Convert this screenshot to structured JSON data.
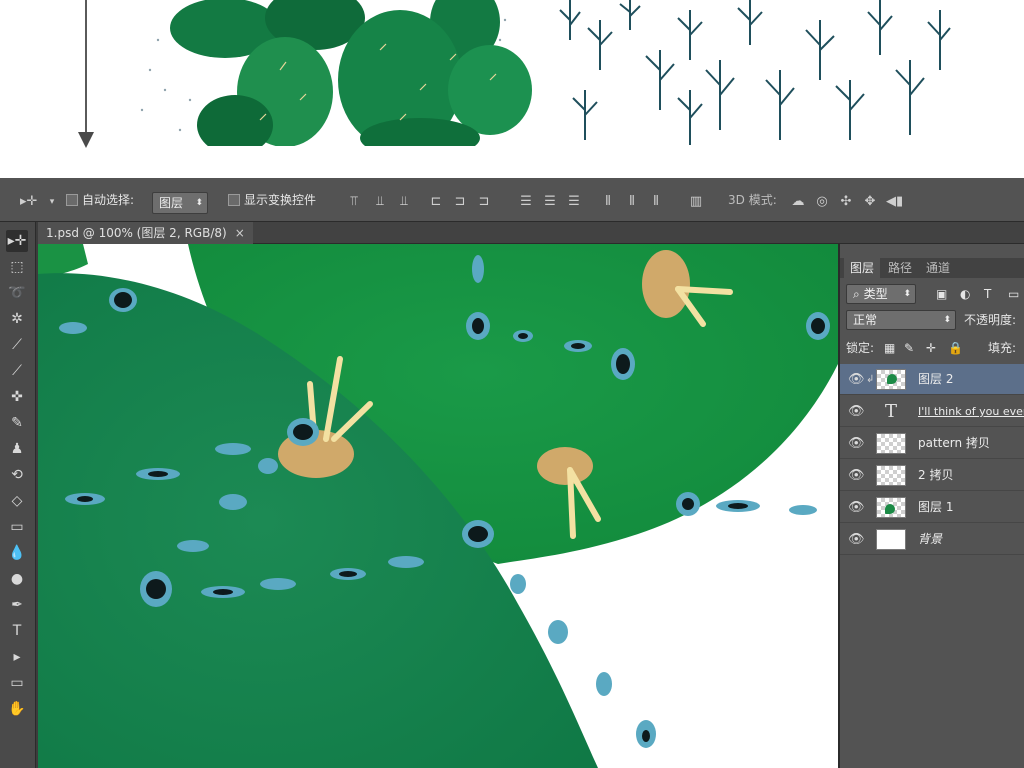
{
  "options_bar": {
    "auto_select_label": "自动选择:",
    "auto_select_target": "图层",
    "show_transform_label": "显示变换控件",
    "mode_3d_label": "3D 模式:"
  },
  "document": {
    "tab_title": "1.psd @ 100% (图层 2, RGB/8)",
    "tab_close": "×"
  },
  "panel": {
    "tabs": [
      "图层",
      "路径",
      "通道"
    ],
    "filter_kind": "类型",
    "blend_mode": "正常",
    "opacity_label": "不透明度:",
    "lock_label": "锁定:",
    "fill_label": "填充:",
    "layers": [
      {
        "name": "图层 2",
        "kind": "image",
        "selected": true
      },
      {
        "name": "I'll think of you every",
        "kind": "type",
        "selected": false
      },
      {
        "name": "pattern 拷贝",
        "kind": "empty",
        "selected": false
      },
      {
        "name": "2 拷贝",
        "kind": "empty",
        "selected": false
      },
      {
        "name": "图层 1",
        "kind": "image",
        "selected": false
      },
      {
        "name": "背景",
        "kind": "white",
        "selected": false
      }
    ]
  },
  "icons": {
    "eye": "eye-icon",
    "move": "move-tool-icon"
  },
  "colors": {
    "cactus_dark": "#137a43",
    "cactus_light": "#1f9a3a",
    "spine": "#f2dc9a",
    "areole": "#d4b078",
    "dot": "#5aa7bf",
    "selected_layer": "#5c6f8a"
  }
}
